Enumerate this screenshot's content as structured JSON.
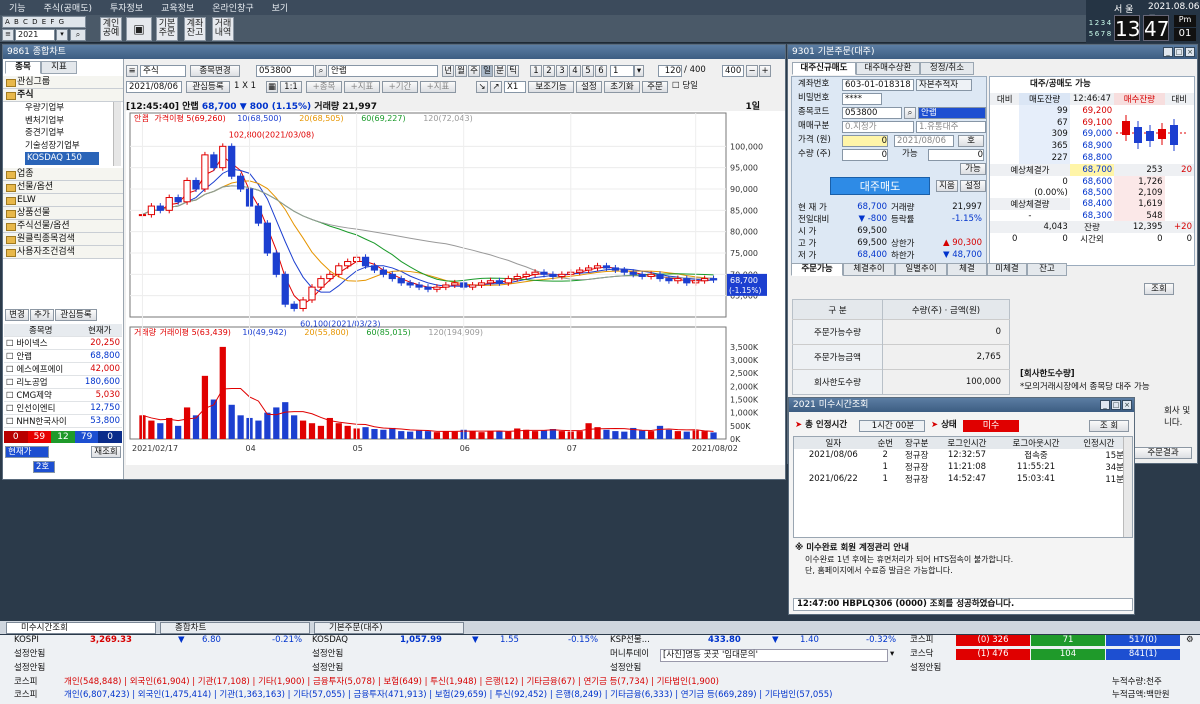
{
  "menu": [
    "기능",
    "주식(공매도)",
    "투자정보",
    "교육정보",
    "온라인창구",
    "보기"
  ],
  "toolbar": {
    "alpha": "A B C D E F G",
    "alpha2": "H I J K L M N",
    "year": "2021",
    "b1": "계인공예",
    "b3": "기본주문",
    "b4": "계좌잔고",
    "b5": "거래내역"
  },
  "clock": {
    "region": "서 울",
    "date": "2021.08.06 금",
    "hour": "13",
    "min": "47",
    "ampm": "Pm",
    "sec": "01",
    "pad": [
      "1",
      "2",
      "3",
      "4",
      "5",
      "6",
      "7",
      "8"
    ]
  },
  "chartwin": {
    "title": "9861 종합차트",
    "lefttabs": [
      "종목",
      "지표"
    ],
    "groups": [
      "관심그룹",
      "주식"
    ],
    "subitems": [
      "우량기업부",
      "벤처기업부",
      "중견기업부",
      "기술성장기업부",
      "KOSDAQ 150"
    ],
    "groups2": [
      "업종",
      "선물/옵션",
      "ELW",
      "상품선물",
      "주식선물/옵션",
      "원클릭종목검색",
      "사용자조건검색"
    ],
    "wl_btns": [
      "변경",
      "추가",
      "관심등록"
    ],
    "wl_head": [
      "종목명",
      "현재가"
    ],
    "watch": [
      [
        "바이넥스",
        "20,250"
      ],
      [
        "안랩",
        "68,800"
      ],
      [
        "에스에프에이",
        "42,000"
      ],
      [
        "리노공업",
        "180,600"
      ],
      [
        "CMG제약",
        "5,030"
      ],
      [
        "인선이엔티",
        "12,750"
      ],
      [
        "NHN한국사이",
        "53,800"
      ]
    ],
    "counts": [
      "0",
      "59",
      "12",
      "79",
      "0"
    ],
    "cur": "현재가",
    "ret": "재조회",
    "sel": "2호",
    "ctrl": {
      "type": "주식",
      "chg": "종목변경",
      "code": "053800",
      "name": "안랩",
      "period": [
        "년",
        "월",
        "주",
        "일",
        "분",
        "틱"
      ],
      "nums": [
        "1",
        "2",
        "3",
        "4",
        "5",
        "6"
      ],
      "n1": "1",
      "cnt": "120",
      "slash": "/ 400",
      "max": "400",
      "date": "2021/08/06",
      "reg": "관심등록",
      "x1": "1 X 1",
      "ind": [
        "+종목",
        "+지표",
        "+기간",
        "+지표"
      ],
      "x1b": "X1",
      "tools": [
        "보조기능",
        "설정",
        "초기화",
        "주문"
      ],
      "today": "당일"
    },
    "info": {
      "time": "[12:45:40]",
      "name": "안랩",
      "price": "68,700",
      "chg": "▼ 800",
      "pct": "(1.15%)",
      "vol_lbl": "거래량",
      "vol": "21,997",
      "period": "1일"
    },
    "legend": [
      "안랩",
      "가격이평 5(69,260)",
      "10(68,500)",
      "20(68,505)",
      "60(69,227)",
      "120(72,043)"
    ],
    "vlegend": [
      "거래량",
      "거래이평 5(63,439)",
      "10(49,942)",
      "20(55,800)",
      "60(85,015)",
      "120(194,909)"
    ],
    "hi": "102,800(2021/03/08)",
    "lo": "60,100(2021/03/23)",
    "cur_tag": "68,700",
    "cur_pct": "(-1.15%)",
    "yaxis": [
      "100,000",
      "95,000",
      "90,000",
      "85,000",
      "80,000",
      "75,000",
      "70,000",
      "65,000"
    ],
    "vaxis": [
      "3,500K",
      "3,000K",
      "2,500K",
      "2,000K",
      "1,500K",
      "1,000K",
      "500K",
      "0K"
    ],
    "xaxis": [
      "2021/02/17",
      "04",
      "05",
      "06",
      "07",
      "2021/08/02"
    ]
  },
  "orderwin": {
    "title": "9301 기본주문(대주)",
    "tabs": [
      "대주신규매도",
      "대주매수상환",
      "정정/취소"
    ],
    "acct_l": "계좌번호",
    "acct": "603-01-018318",
    "acct_type": "자본추적자",
    "pw_l": "비밀번호",
    "pw": "****",
    "code_l": "종목코드",
    "code": "053800",
    "name": "안랩",
    "trade_l": "매매구분",
    "trade": "0.지정가",
    "cond": "1.유통대주",
    "price_l": "가격 (원)",
    "price": "0",
    "date": "2021/08/06",
    "ho": "호",
    "qty_l": "수량 (주)",
    "qty": "0",
    "able": "가능",
    "able_v": "0",
    "sellbtn": "대주매도",
    "b_jj": "지움",
    "b_set": "설정",
    "b_able": "가능",
    "q": [
      [
        "현 재 가",
        "68,700",
        "거래량",
        "21,997"
      ],
      [
        "전일대비",
        "-800",
        "등락률",
        "-1.15%"
      ],
      [
        "시 가",
        "69,500",
        "",
        ""
      ],
      [
        "고 가",
        "69,500",
        "상한가",
        "90,300"
      ],
      [
        "저 가",
        "68,400",
        "하한가",
        "48,700"
      ]
    ],
    "ob_title": "대주/공매도 가능",
    "ob_head": [
      "대비",
      "매도잔량",
      "12:46:47",
      "매수잔량",
      "대비"
    ],
    "asks": [
      [
        "99",
        "69,200"
      ],
      [
        "67",
        "69,100"
      ],
      [
        "309",
        "69,000"
      ],
      [
        "365",
        "68,900"
      ],
      [
        "227",
        "68,800"
      ]
    ],
    "exp_l": "예상체결가",
    "exp": "68,700",
    "exp_q": "253",
    "exp_d": "20",
    "bids": [
      [
        "68,600",
        "1,726"
      ],
      [
        "68,500",
        "2,109"
      ],
      [
        "68,400",
        "1,619"
      ],
      [
        "68,300",
        "548"
      ]
    ],
    "e1": "0",
    "e2": "(0.00%)",
    "expvol_l": "예상체결량",
    "expvol": "-",
    "tot_l": "잔량",
    "tot_a": "4,043",
    "tot_b": "12,395",
    "tot_d": "+20",
    "aft_l": "시간외",
    "aft": [
      "0",
      "0",
      "0",
      "0"
    ],
    "bt": [
      "주문가능",
      "체결추이",
      "일별추이",
      "체결",
      "미체결",
      "잔고"
    ],
    "inq": "조회",
    "tbl_head": [
      "구 분",
      "수량(주) · 금액(원)"
    ],
    "rows": [
      [
        "주문가능수량",
        "0"
      ],
      [
        "주문가능금액",
        "2,765"
      ],
      [
        "회사한도수량",
        "100,000"
      ]
    ],
    "notice_t": "[회사한도수량]",
    "notice": "*모의거래시장에서 종목당 대주 가능",
    "notice2": "회사 및",
    "notice3": "니다.",
    "b_more": "주문결과"
  },
  "dlg": {
    "title": "2021 미수시간조회",
    "tot_l": "총 인정시간",
    "tot": "1시간 00분",
    "st_l": "상태",
    "st": "미수",
    "inq": "조 회",
    "head": [
      "일자",
      "순번",
      "장구분",
      "로그인시간",
      "로그아웃시간",
      "인정시간"
    ],
    "rows": [
      [
        "2021/08/06",
        "2",
        "정규장",
        "12:32:57",
        "접속중",
        "15분"
      ],
      [
        "",
        "1",
        "정규장",
        "11:21:08",
        "11:55:21",
        "34분"
      ],
      [
        "2021/06/22",
        "1",
        "정규장",
        "14:52:47",
        "15:03:41",
        "11분"
      ]
    ],
    "note_t": "※ 미수완료 회원 계정관리 안내",
    "note1": "이수완료 1년 후에는 휴면처리가 되어 HTS접속이 불가합니다.",
    "note2": "단, 홈페이지에서 수료증 발급은 가능합니다.",
    "status": "12:47:00 HBPLQ306 (0000) 조회를 성공하였습니다."
  },
  "tasks": [
    "미수시간조회",
    "종합차트",
    "기본주문(대주)"
  ],
  "bottom": {
    "r1": {
      "kospi_l": "KOSPI",
      "kospi": "3,269.33",
      "k_ch": "▼",
      "k_c": "6.80",
      "k_p": "-0.21%",
      "kq_l": "KOSDAQ",
      "kq": "1,057.99",
      "kq_ch": "▼",
      "kq_c": "1.55",
      "kq_p": "-0.15%",
      "fut_l": "KSP선물...",
      "fut": "433.80",
      "f_ch": "▼",
      "f_c": "1.40",
      "f_p": "-0.32%",
      "m_l": "코스피",
      "m1": "(0) 326",
      "m2": "71",
      "m3": "517(0)"
    },
    "r2": {
      "a": "설정안됨",
      "b": "설정안됨",
      "c": "머니투데이",
      "news": "[사진]명동 곳곳 '임대문의'",
      "m_l": "코스닥",
      "m1": "(1) 476",
      "m2": "104",
      "m3": "841(1)"
    },
    "r3": {
      "a": "설정안됨",
      "b": "설정안됨",
      "c": "설정안됨",
      "d": "설정안됨"
    },
    "r4_l": "코스피",
    "r4": "개인(548,848) | 외국인(61,904) | 기관(17,108) | 기타(1,900) | 금융투자(5,078) | 보험(649) | 투신(1,948) | 은행(12) | 기타금융(67) | 연기금 등(7,734) | 기타법인(1,900)",
    "r4_r": "누적수량:천주",
    "r5_l": "코스피",
    "r5": "개인(6,807,423) | 외국인(1,475,414) | 기관(1,363,163) | 기타(57,055) | 금융투자(471,913) | 보험(29,659) | 투신(92,452) | 은행(8,249) | 기타금융(6,333) | 연기금 등(669,289) | 기타법인(57,055)",
    "r5_r": "누적금액:백만원"
  },
  "chart_data": {
    "type": "candlestick",
    "title": "",
    "x": [
      "2021/02/17",
      "2021/08/02"
    ],
    "ylim": [
      60000,
      105000
    ],
    "close_last": 68700,
    "high": {
      "date": "2021/03/08",
      "value": 102800
    },
    "low": {
      "date": "2021/03/23",
      "value": 60100
    },
    "closes": [
      84000,
      86000,
      85000,
      88000,
      87000,
      92000,
      90000,
      98000,
      95000,
      100000,
      93000,
      90000,
      86000,
      82000,
      75000,
      70000,
      63000,
      62000,
      64000,
      67000,
      69000,
      70000,
      72000,
      73000,
      74000,
      72000,
      71000,
      70000,
      69000,
      68000,
      67500,
      67000,
      66500,
      67000,
      67500,
      68000,
      67000,
      67500,
      68000,
      68500,
      68000,
      69000,
      69500,
      70000,
      70500,
      70000,
      69500,
      70000,
      70500,
      71000,
      71500,
      72000,
      71500,
      71000,
      70500,
      70000,
      69500,
      70000,
      69000,
      68500,
      69000,
      68000,
      68500,
      69000,
      68700
    ],
    "volumes_k": [
      900,
      700,
      600,
      800,
      500,
      1200,
      900,
      2400,
      1500,
      3500,
      1300,
      900,
      800,
      700,
      1000,
      1200,
      1400,
      900,
      700,
      600,
      500,
      800,
      600,
      500,
      400,
      450,
      380,
      350,
      420,
      300,
      280,
      320,
      300,
      260,
      300,
      280,
      350,
      300,
      260,
      310,
      300,
      280,
      400,
      350,
      300,
      320,
      380,
      300,
      280,
      300,
      600,
      450,
      350,
      300,
      280,
      420,
      320,
      300,
      500,
      350,
      300,
      280,
      320,
      300,
      250
    ]
  }
}
